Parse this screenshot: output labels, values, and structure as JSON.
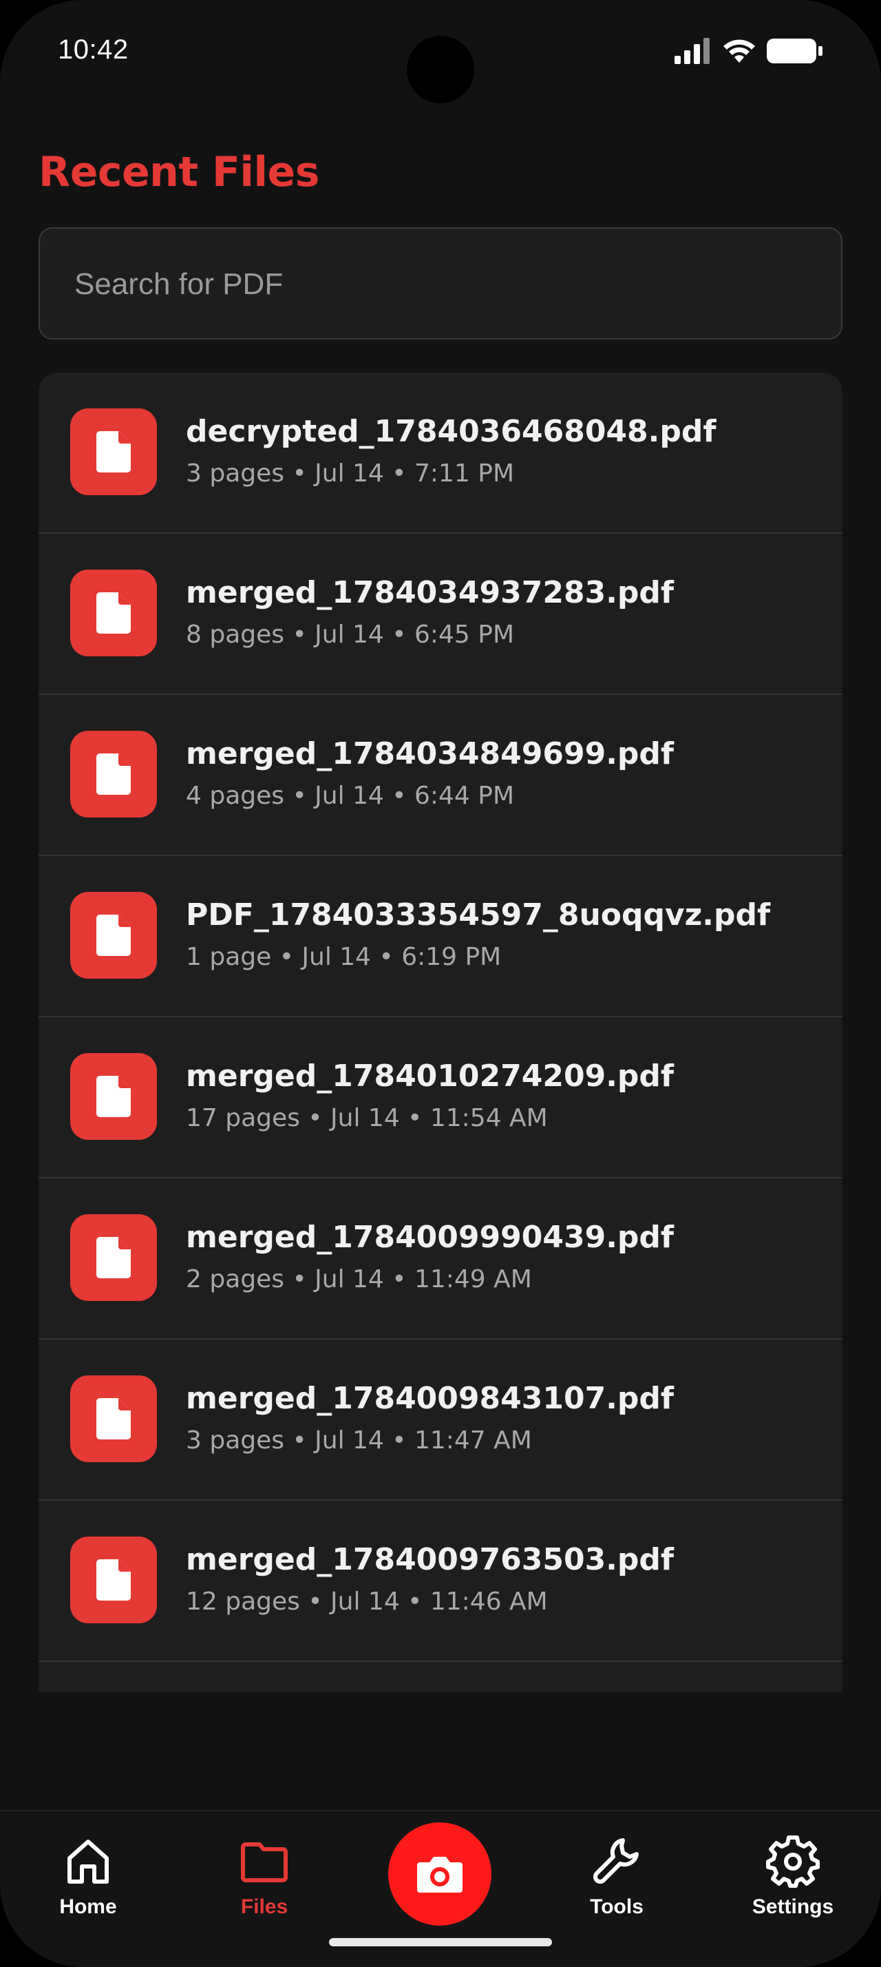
{
  "status_bar": {
    "time": "10:42"
  },
  "header": {
    "title": "Recent Files"
  },
  "search": {
    "placeholder": "Search for PDF",
    "value": ""
  },
  "files": [
    {
      "name": "decrypted_1784036468048.pdf",
      "meta": "3 pages • Jul 14 • 7:11 PM"
    },
    {
      "name": "merged_1784034937283.pdf",
      "meta": "8 pages • Jul 14 • 6:45 PM"
    },
    {
      "name": "merged_1784034849699.pdf",
      "meta": "4 pages • Jul 14 • 6:44 PM"
    },
    {
      "name": "PDF_1784033354597_8uoqqvz.pdf",
      "meta": "1 page • Jul 14 • 6:19 PM"
    },
    {
      "name": "merged_1784010274209.pdf",
      "meta": "17 pages • Jul 14 • 11:54 AM"
    },
    {
      "name": "merged_1784009990439.pdf",
      "meta": "2 pages • Jul 14 • 11:49 AM"
    },
    {
      "name": "merged_1784009843107.pdf",
      "meta": "3 pages • Jul 14 • 11:47 AM"
    },
    {
      "name": "merged_1784009763503.pdf",
      "meta": "12 pages • Jul 14 • 11:46 AM"
    }
  ],
  "bottom_nav": {
    "items": [
      {
        "label": "Home",
        "icon": "home-icon",
        "active": false
      },
      {
        "label": "Files",
        "icon": "folder-icon",
        "active": true
      },
      {
        "label": "",
        "icon": "camera-icon",
        "active": false
      },
      {
        "label": "Tools",
        "icon": "wrench-icon",
        "active": false
      },
      {
        "label": "Settings",
        "icon": "gear-icon",
        "active": false
      }
    ]
  },
  "colors": {
    "accent": "#E53935",
    "fab": "#FF1A1A",
    "background": "#121212",
    "list_background": "#1e1e1e"
  }
}
